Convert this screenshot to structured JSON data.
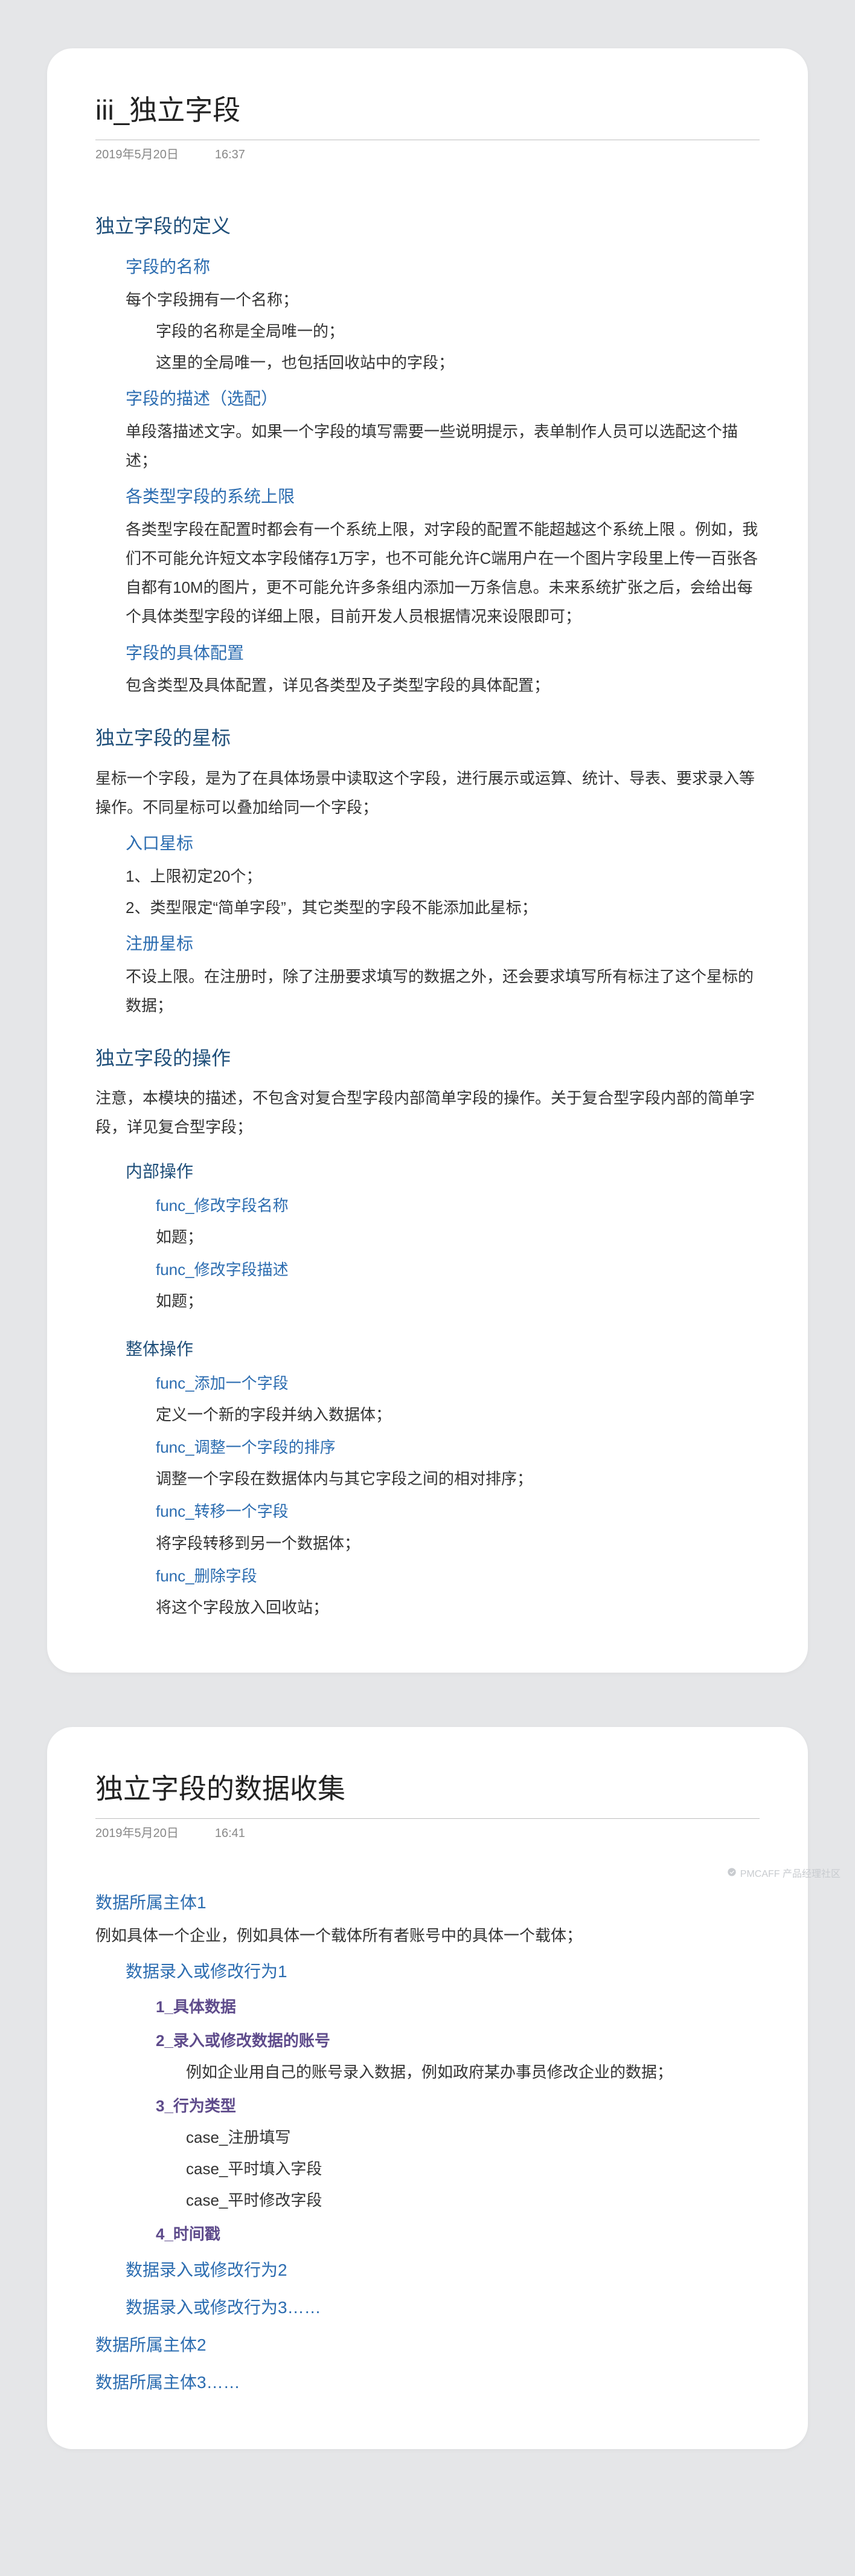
{
  "card1": {
    "title": "iii_独立字段",
    "date": "2019年5月20日",
    "time": "16:37",
    "sections": [
      {
        "h1": "独立字段的定义",
        "blocks": [
          {
            "h2": "字段的名称",
            "lines": [
              {
                "text": "每个字段拥有一个名称；",
                "ind": 1
              },
              {
                "text": "字段的名称是全局唯一的；",
                "ind": 2
              },
              {
                "text": "这里的全局唯一，也包括回收站中的字段；",
                "ind": 2
              }
            ]
          },
          {
            "h2": "字段的描述（选配）",
            "lines": [
              {
                "text": "单段落描述文字。如果一个字段的填写需要一些说明提示，表单制作人员可以选配这个描述；",
                "ind": 1
              }
            ]
          },
          {
            "h2": "各类型字段的系统上限",
            "lines": [
              {
                "text": "各类型字段在配置时都会有一个系统上限，对字段的配置不能超越这个系统上限 。例如，我们不可能允许短文本字段储存1万字，也不可能允许C端用户在一个图片字段里上传一百张各自都有10M的图片，更不可能允许多条组内添加一万条信息。未来系统扩张之后，会给出每个具体类型字段的详细上限，目前开发人员根据情况来设限即可；",
                "ind": 1
              }
            ]
          },
          {
            "h2": "字段的具体配置",
            "lines": [
              {
                "text": "包含类型及具体配置，详见各类型及子类型字段的具体配置；",
                "ind": 1
              }
            ]
          }
        ]
      },
      {
        "h1": "独立字段的星标",
        "intro": "星标一个字段，是为了在具体场景中读取这个字段，进行展示或运算、统计、导表、要求录入等操作。不同星标可以叠加给同一个字段；",
        "blocks": [
          {
            "h2": "入口星标",
            "lines": [
              {
                "text": "1、上限初定20个；",
                "ind": 1
              },
              {
                "text": "2、类型限定“简单字段”，其它类型的字段不能添加此星标；",
                "ind": 1
              }
            ]
          },
          {
            "h2": "注册星标",
            "lines": [
              {
                "text": "不设上限。在注册时，除了注册要求填写的数据之外，还会要求填写所有标注了这个星标的数据；",
                "ind": 1
              }
            ]
          }
        ]
      },
      {
        "h1": "独立字段的操作",
        "intro": "注意，本模块的描述，不包含对复合型字段内部简单字段的操作。关于复合型字段内部的简单字段，详见复合型字段；",
        "blocks": [
          {
            "h2": "内部操作",
            "h2ind": 1,
            "lines": [
              {
                "link": "func_修改字段名称",
                "ind": 2
              },
              {
                "text": "如题；",
                "ind": 2
              },
              {
                "link": "func_修改字段描述",
                "ind": 2
              },
              {
                "text": "如题；",
                "ind": 2
              }
            ]
          },
          {
            "h2": "整体操作",
            "h2ind": 1,
            "lines": [
              {
                "link": "func_添加一个字段",
                "ind": 2
              },
              {
                "text": "定义一个新的字段并纳入数据体；",
                "ind": 2
              },
              {
                "link": "func_调整一个字段的排序",
                "ind": 2
              },
              {
                "text": "调整一个字段在数据体内与其它字段之间的相对排序；",
                "ind": 2
              },
              {
                "link": "func_转移一个字段",
                "ind": 2
              },
              {
                "text": "将字段转移到另一个数据体；",
                "ind": 2
              },
              {
                "link": "func_删除字段",
                "ind": 2
              },
              {
                "text": "将这个字段放入回收站；",
                "ind": 2
              }
            ]
          }
        ]
      }
    ]
  },
  "card2": {
    "title": "独立字段的数据收集",
    "date": "2019年5月20日",
    "time": "16:41",
    "body": {
      "owner1": {
        "heading": "数据所属主体1",
        "desc": "例如具体一个企业，例如具体一个载体所有者账号中的具体一个载体；",
        "action1": {
          "heading": "数据录入或修改行为1",
          "p1": "1_具体数据",
          "p2": "2_录入或修改数据的账号",
          "p2_desc": "例如企业用自己的账号录入数据，例如政府某办事员修改企业的数据；",
          "p3": "3_行为类型",
          "cases": [
            "case_注册填写",
            "case_平时填入字段",
            "case_平时修改字段"
          ],
          "p4": "4_时间戳"
        },
        "action2": "数据录入或修改行为2",
        "action3": "数据录入或修改行为3……"
      },
      "owner2": "数据所属主体2",
      "owner3": "数据所属主体3……"
    }
  },
  "watermark": "PMCAFF 产品经理社区"
}
